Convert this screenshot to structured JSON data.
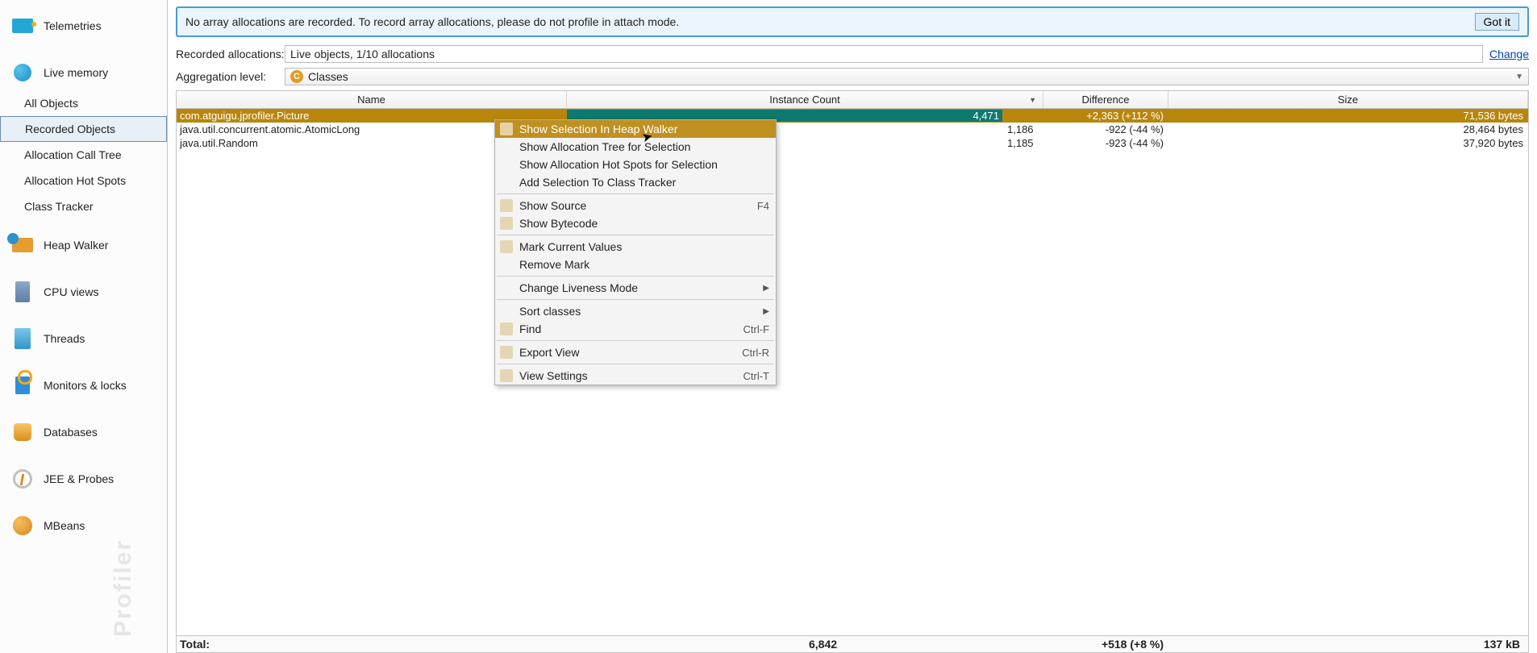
{
  "sidebar": {
    "items": [
      {
        "label": "Telemetries"
      },
      {
        "label": "Live memory"
      },
      {
        "label": "Heap Walker"
      },
      {
        "label": "CPU views"
      },
      {
        "label": "Threads"
      },
      {
        "label": "Monitors & locks"
      },
      {
        "label": "Databases"
      },
      {
        "label": "JEE & Probes"
      },
      {
        "label": "MBeans"
      }
    ],
    "subitems": [
      {
        "label": "All Objects"
      },
      {
        "label": "Recorded Objects"
      },
      {
        "label": "Allocation Call Tree"
      },
      {
        "label": "Allocation Hot Spots"
      },
      {
        "label": "Class Tracker"
      }
    ]
  },
  "banner": {
    "message": "No array allocations are recorded. To record array allocations, please do not profile in attach mode.",
    "button": "Got it"
  },
  "recorded": {
    "label": "Recorded allocations:",
    "value": "Live objects, 1/10 allocations",
    "change": "Change"
  },
  "aggregation": {
    "label": "Aggregation level:",
    "badge": "C",
    "value": "Classes"
  },
  "headers": {
    "name": "Name",
    "count": "Instance Count",
    "diff": "Difference",
    "size": "Size"
  },
  "rows": [
    {
      "name": "com.atguigu.jprofiler.Picture",
      "count": "4,471",
      "diff": "+2,363 (+112 %)",
      "size": "71,536 bytes",
      "bar_pct": 100,
      "selected": true,
      "bar_color": "teal"
    },
    {
      "name": "java.util.concurrent.atomic.AtomicLong",
      "count": "1,186",
      "diff": "-922 (-44 %)",
      "size": "28,464 bytes",
      "bar_pct": 27,
      "selected": false,
      "bar_color": "brown"
    },
    {
      "name": "java.util.Random",
      "count": "1,185",
      "diff": "-923 (-44 %)",
      "size": "37,920 bytes",
      "bar_pct": 27,
      "selected": false,
      "bar_color": "brown"
    }
  ],
  "total": {
    "label": "Total:",
    "count": "6,842",
    "diff": "+518 (+8 %)",
    "size": "137 kB"
  },
  "context_menu": {
    "items": [
      {
        "label": "Show Selection In Heap Walker",
        "selected": true,
        "icon": "walk"
      },
      {
        "label": "Show Allocation Tree for Selection"
      },
      {
        "label": "Show Allocation Hot Spots for Selection"
      },
      {
        "label": "Add Selection To Class Tracker"
      },
      {
        "sep": true
      },
      {
        "label": "Show Source",
        "shortcut": "F4",
        "icon": "src"
      },
      {
        "label": "Show Bytecode",
        "icon": "byte"
      },
      {
        "sep": true
      },
      {
        "label": "Mark Current Values",
        "icon": "mark"
      },
      {
        "label": "Remove Mark"
      },
      {
        "sep": true
      },
      {
        "label": "Change Liveness Mode",
        "submenu": true
      },
      {
        "sep": true
      },
      {
        "label": "Sort classes",
        "submenu": true
      },
      {
        "label": "Find",
        "shortcut": "Ctrl-F",
        "icon": "find"
      },
      {
        "sep": true
      },
      {
        "label": "Export View",
        "shortcut": "Ctrl-R",
        "icon": "export"
      },
      {
        "sep": true
      },
      {
        "label": "View Settings",
        "shortcut": "Ctrl-T",
        "icon": "settings"
      }
    ]
  },
  "watermark": "Profiler"
}
